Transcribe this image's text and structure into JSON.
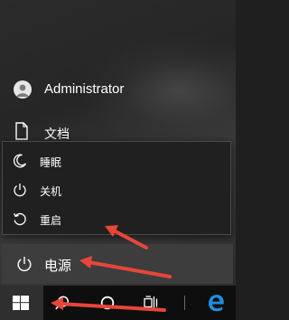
{
  "user": {
    "name": "Administrator",
    "avatar_icon": "user-avatar-icon"
  },
  "places": {
    "documents_label": "文档",
    "documents_icon": "document-icon"
  },
  "power_menu": {
    "items": [
      {
        "label": "睡眠",
        "icon": "moon-icon"
      },
      {
        "label": "关机",
        "icon": "power-icon"
      },
      {
        "label": "重启",
        "icon": "restart-icon"
      }
    ]
  },
  "power_button": {
    "label": "电源",
    "icon": "power-icon"
  },
  "taskbar": {
    "items": [
      "windows-logo-icon",
      "search-icon",
      "cortana-icon",
      "task-view-icon",
      "edge-browser-icon"
    ]
  },
  "colors": {
    "annotation_arrow": "#e8463a",
    "edge_blue": "#1f8fe0",
    "menu_bg": "#202020"
  }
}
